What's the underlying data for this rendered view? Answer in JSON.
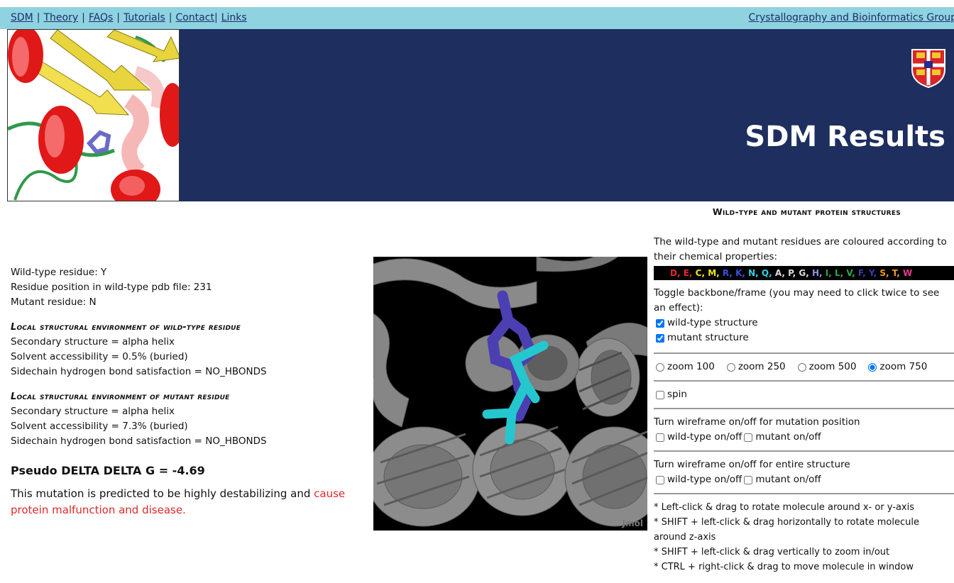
{
  "nav": {
    "links": [
      "SDM",
      "Theory",
      "FAQs",
      "Tutorials",
      "Contact",
      "Links"
    ],
    "group_link": "Crystallography and Bioinformatics Group"
  },
  "banner": {
    "title": "SDM Results"
  },
  "results": {
    "wild_type_residue": "Wild-type residue: Y",
    "residue_position": "Residue position in wild-type pdb file: 231",
    "mutant_residue": "Mutant residue: N",
    "wt_env_header": "Local structural environment of wild-type residue",
    "wt_secondary": "Secondary structure = alpha helix",
    "wt_solvent": "Solvent accessibility = 0.5% (buried)",
    "wt_hbond": "Sidechain hydrogen bond satisfaction = NO_HBONDS",
    "mut_env_header": "Local structural environment of mutant residue",
    "mut_secondary": "Secondary structure = alpha helix",
    "mut_solvent": "Solvent accessibility = 7.3% (buried)",
    "mut_hbond": "Sidechain hydrogen bond satisfaction = NO_HBONDS",
    "ddg": "Pseudo DELTA DELTA G = -4.69",
    "verdict_prefix": "This mutation is predicted to be highly destabilizing and ",
    "verdict_red": "cause protein malfunction and disease."
  },
  "viewer": {
    "watermark": "Jmol"
  },
  "controls": {
    "title": "Wild-type and mutant protein structures",
    "colour_intro": "The wild-type and mutant residues are coloured according to their chemical properties:",
    "residue_colours": [
      {
        "code": "D",
        "color": "#e8262a"
      },
      {
        "code": "E",
        "color": "#e8262a"
      },
      {
        "code": "C",
        "color": "#f2e227"
      },
      {
        "code": "M",
        "color": "#f2e227"
      },
      {
        "code": "R",
        "color": "#3a4fe0"
      },
      {
        "code": "K",
        "color": "#3a4fe0"
      },
      {
        "code": "N",
        "color": "#2fd3e4"
      },
      {
        "code": "Q",
        "color": "#2fd3e4"
      },
      {
        "code": "A",
        "color": "#dcdcdc"
      },
      {
        "code": "P",
        "color": "#dcdcdc"
      },
      {
        "code": "G",
        "color": "#dcdcdc"
      },
      {
        "code": "H",
        "color": "#8f8fe6"
      },
      {
        "code": "I",
        "color": "#2fa84c"
      },
      {
        "code": "L",
        "color": "#2fa84c"
      },
      {
        "code": "V",
        "color": "#2fa84c"
      },
      {
        "code": "F",
        "color": "#3c3cb0"
      },
      {
        "code": "Y",
        "color": "#3c3cb0"
      },
      {
        "code": "S",
        "color": "#f39a1c"
      },
      {
        "code": "T",
        "color": "#f39a1c"
      },
      {
        "code": "W",
        "color": "#e8368f"
      }
    ],
    "toggle_intro": "Toggle backbone/frame (you may need to click twice to see an effect):",
    "wild_type_structure": "wild-type structure",
    "mutant_structure": "mutant structure",
    "zoom_options": [
      "zoom 100",
      "zoom 250",
      "zoom 500",
      "zoom 750"
    ],
    "zoom_selected": "zoom 750",
    "spin": "spin",
    "wire_mut_intro": "Turn wireframe on/off for mutation position",
    "wire_entire_intro": "Turn wireframe on/off for entire structure",
    "wt_onoff": "wild-type on/off",
    "mut_onoff": "mutant on/off",
    "help": [
      "* Left-click & drag to rotate molecule around x- or y-axis",
      "* SHIFT + left-click & drag horizontally to rotate molecule around z-axis",
      "* SHIFT + left-click & drag vertically to zoom in/out",
      "* CTRL + right-click & drag to move molecule in window"
    ]
  }
}
